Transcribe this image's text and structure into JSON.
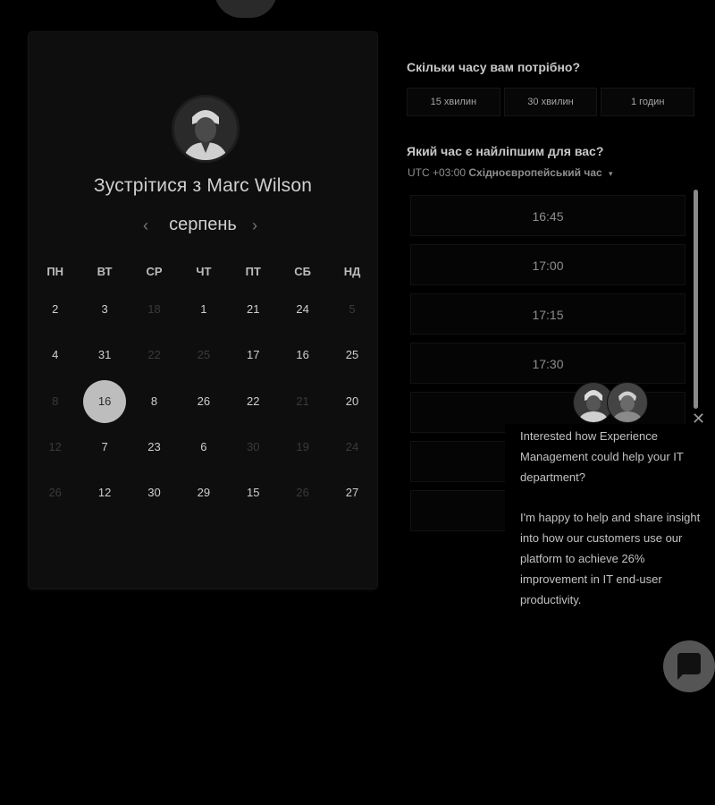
{
  "booking": {
    "title": "Зустрітися з Marc Wilson",
    "month": "серпень",
    "weekdays": [
      "ПН",
      "ВТ",
      "СР",
      "ЧТ",
      "ПТ",
      "СБ",
      "НД"
    ],
    "weeks": [
      [
        {
          "d": "2",
          "dim": false
        },
        {
          "d": "3",
          "dim": false
        },
        {
          "d": "18",
          "dim": true
        },
        {
          "d": "1",
          "dim": false
        },
        {
          "d": "21",
          "dim": false
        },
        {
          "d": "24",
          "dim": false
        },
        {
          "d": "5",
          "dim": true
        }
      ],
      [
        {
          "d": "4",
          "dim": false
        },
        {
          "d": "31",
          "dim": false
        },
        {
          "d": "22",
          "dim": true
        },
        {
          "d": "25",
          "dim": true
        },
        {
          "d": "17",
          "dim": false
        },
        {
          "d": "16",
          "dim": false
        },
        {
          "d": "25",
          "dim": false
        }
      ],
      [
        {
          "d": "8",
          "dim": true
        },
        {
          "d": "16",
          "dim": false,
          "selected": true
        },
        {
          "d": "8",
          "dim": false
        },
        {
          "d": "26",
          "dim": false
        },
        {
          "d": "22",
          "dim": false
        },
        {
          "d": "21",
          "dim": true
        },
        {
          "d": "20",
          "dim": false
        }
      ],
      [
        {
          "d": "12",
          "dim": true
        },
        {
          "d": "7",
          "dim": false
        },
        {
          "d": "23",
          "dim": false
        },
        {
          "d": "6",
          "dim": false
        },
        {
          "d": "30",
          "dim": true
        },
        {
          "d": "19",
          "dim": true
        },
        {
          "d": "24",
          "dim": true
        }
      ],
      [
        {
          "d": "26",
          "dim": true
        },
        {
          "d": "12",
          "dim": false
        },
        {
          "d": "30",
          "dim": false
        },
        {
          "d": "29",
          "dim": false
        },
        {
          "d": "15",
          "dim": false
        },
        {
          "d": "26",
          "dim": true
        },
        {
          "d": "27",
          "dim": false
        }
      ]
    ]
  },
  "duration": {
    "question": "Скільки часу вам потрібно?",
    "options": [
      "15 хвилин",
      "30 хвилин",
      "1 годин"
    ]
  },
  "time": {
    "question": "Який час є найліпшим для вас?",
    "tz_offset": "UTC +03:00",
    "tz_name": "Східноєвропейський час",
    "slots": [
      "16:45",
      "17:00",
      "17:15",
      "17:30",
      "",
      "",
      ""
    ]
  },
  "chat": {
    "message1": "Interested how Experience Management could help your IT department?",
    "message2": "I'm happy to help and share insight into how our customers use our platform to achieve 26% improvement in IT end-user productivity."
  },
  "icons": {
    "prev": "chevron-left-icon",
    "next": "chevron-right-icon",
    "close": "close-icon",
    "caret": "caret-down-icon",
    "chat": "chat-bubble-icon"
  }
}
